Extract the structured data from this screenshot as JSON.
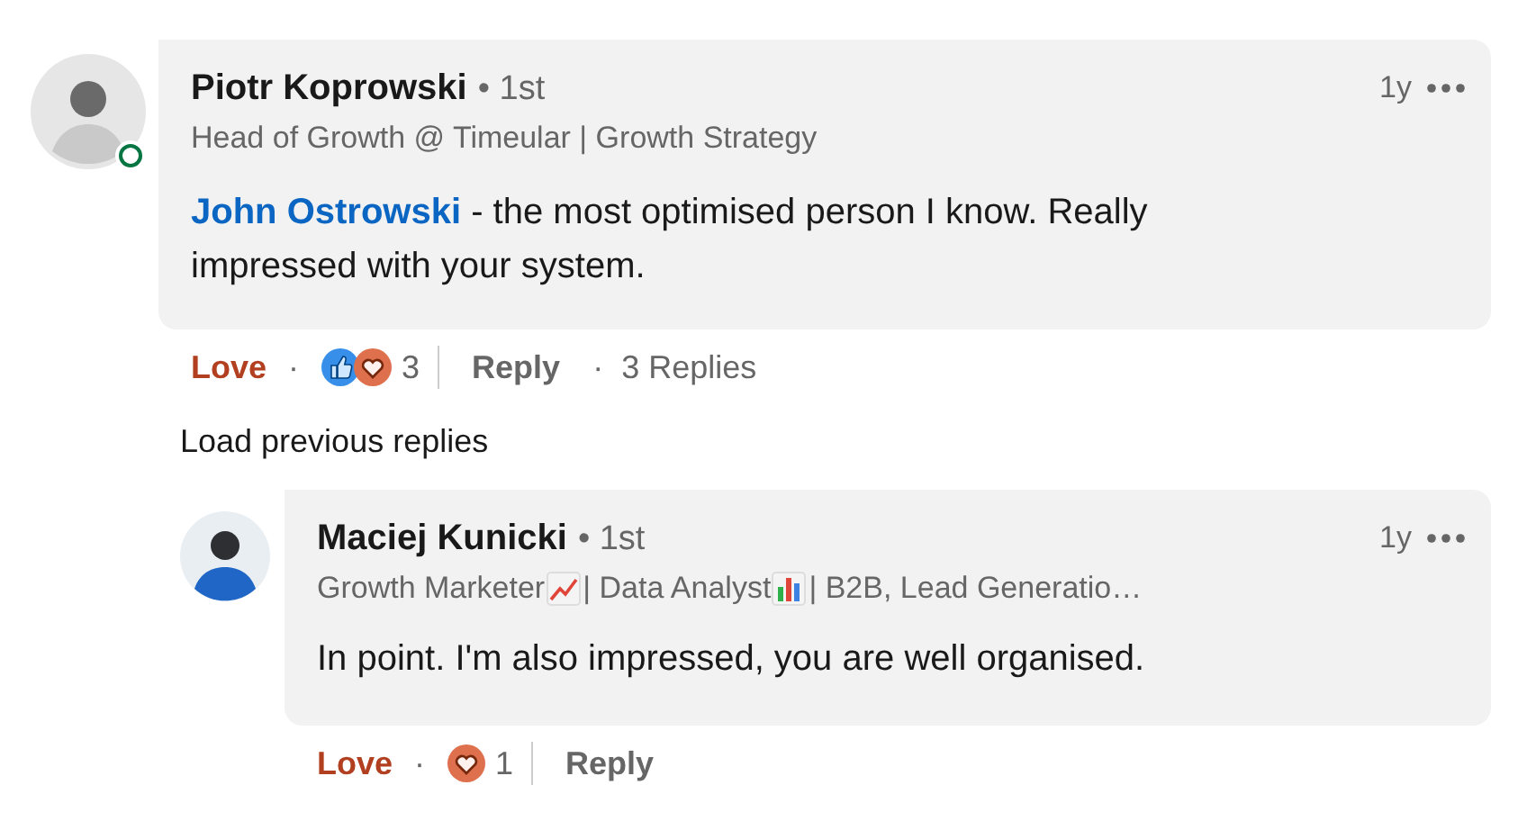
{
  "comments": [
    {
      "author": "Piotr Koprowski",
      "degree": "• 1st",
      "online": true,
      "headline": [
        {
          "kind": "text",
          "text": "Head of Growth @ Timeular | Growth Strategy"
        }
      ],
      "time": "1y",
      "mention": "John Ostrowski",
      "body": " - the most optimised person I know. Really impressed with your system.",
      "reaction_label": "Love",
      "separator": "·",
      "reacted": true,
      "reactions": [
        {
          "kind": "like"
        },
        {
          "kind": "love"
        }
      ],
      "reaction_count": "3",
      "reply_label": "Reply",
      "replies_separator": "·",
      "replies_count": "3 Replies"
    }
  ],
  "load_previous": "Load previous replies",
  "replies": [
    {
      "author": "Maciej Kunicki",
      "degree": "• 1st",
      "headline": [
        {
          "kind": "text",
          "text": "Growth Marketer "
        },
        {
          "kind": "rising"
        },
        {
          "kind": "text",
          "text": "| Data Analyst "
        },
        {
          "kind": "bars"
        },
        {
          "kind": "text",
          "text": "| B2B, Lead Generatio…"
        }
      ],
      "time": "1y",
      "body": "In point. I'm also impressed, you are well organised.",
      "reaction_label": "Love",
      "separator": "·",
      "reacted": true,
      "reactions": [
        {
          "kind": "love"
        }
      ],
      "reaction_count": "1",
      "reply_label": "Reply"
    }
  ]
}
